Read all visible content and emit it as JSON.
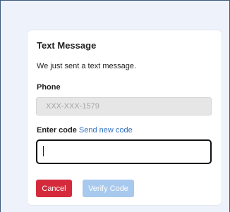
{
  "dialog": {
    "title": "Text Message",
    "subtitle": "We just sent a text message."
  },
  "phone": {
    "label": "Phone",
    "value": "XXX-XXX-1579"
  },
  "code": {
    "label": "Enter code",
    "resend_link": "Send new code",
    "value": ""
  },
  "buttons": {
    "cancel": "Cancel",
    "verify": "Verify Code"
  },
  "colors": {
    "cancel_button": "#d42a3c",
    "verify_button_disabled": "#a8c9ee",
    "link": "#2f6fbe",
    "page_background": "#eef2fb"
  }
}
